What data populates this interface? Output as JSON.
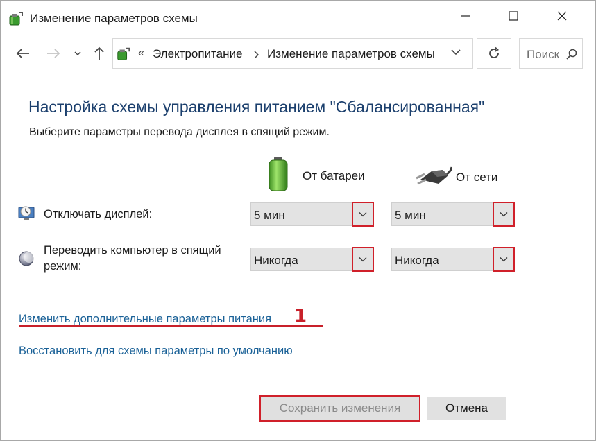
{
  "window": {
    "title": "Изменение параметров схемы"
  },
  "nav": {
    "breadcrumb_separator": "«",
    "crumbs": [
      "Электропитание",
      "Изменение параметров схемы"
    ],
    "search_placeholder": "Поиск"
  },
  "content": {
    "heading": "Настройка схемы управления питанием \"Сбалансированная\"",
    "subtitle": "Выберите параметры перевода дисплея в спящий режим.",
    "columns": {
      "battery": "От батареи",
      "ac": "От сети"
    },
    "rows": [
      {
        "label": "Отключать дисплей:",
        "battery_value": "5 мин",
        "ac_value": "5 мин",
        "icon": "monitor-clock-icon"
      },
      {
        "label_line1": "Переводить компьютер в спящий",
        "label_line2": "режим:",
        "battery_value": "Никогда",
        "ac_value": "Никогда",
        "icon": "moon-icon"
      }
    ],
    "links": {
      "advanced": "Изменить дополнительные параметры питания",
      "restore": "Восстановить для схемы параметры по умолчанию"
    },
    "annotation_number": "1"
  },
  "footer": {
    "save_label": "Сохранить изменения",
    "cancel_label": "Отмена"
  },
  "colors": {
    "heading": "#1b3f6d",
    "link": "#1a6197",
    "highlight": "#d0202a"
  }
}
